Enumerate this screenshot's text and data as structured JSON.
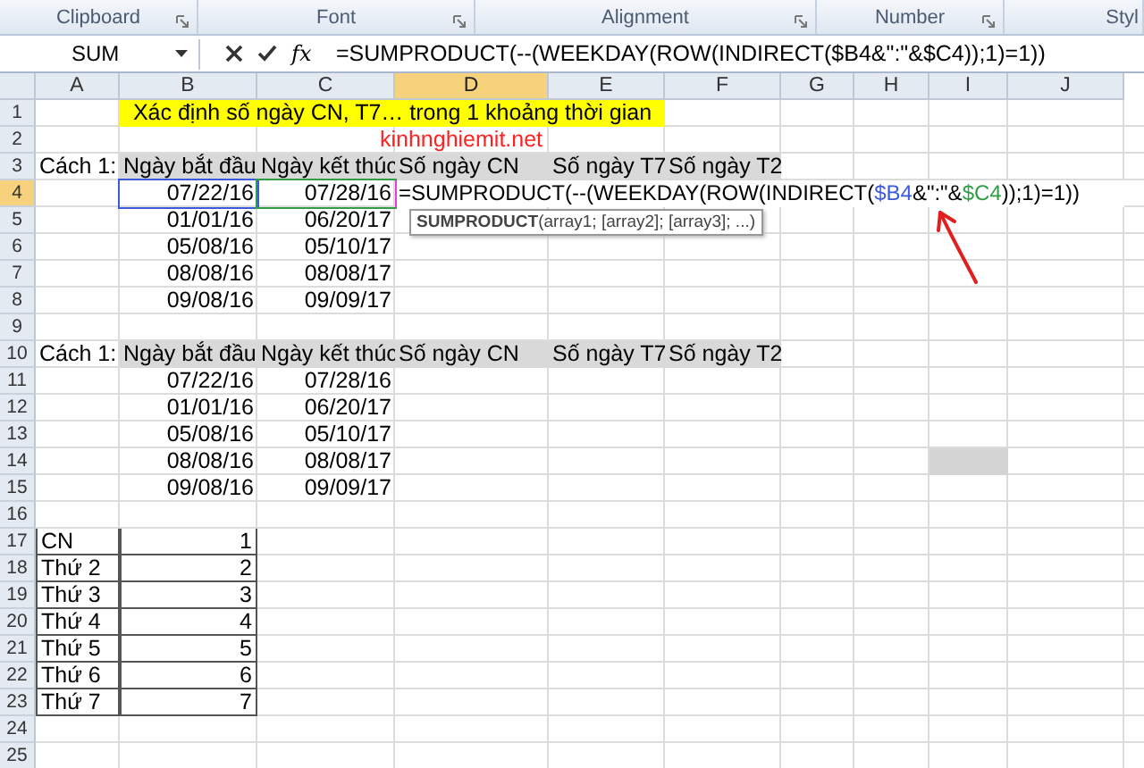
{
  "ribbon": {
    "groups": [
      {
        "label": "Clipboard"
      },
      {
        "label": "Font"
      },
      {
        "label": "Alignment"
      },
      {
        "label": "Number"
      },
      {
        "label": "Styl"
      }
    ]
  },
  "formula_bar": {
    "name_box": "SUM",
    "fx": "fx",
    "formula": "=SUMPRODUCT(--(WEEKDAY(ROW(INDIRECT($B4&\":\"&$C4));1)=1))"
  },
  "columns": [
    {
      "label": "A",
      "selected": false
    },
    {
      "label": "B",
      "selected": false
    },
    {
      "label": "C",
      "selected": false
    },
    {
      "label": "D",
      "selected": true
    },
    {
      "label": "E",
      "selected": false
    },
    {
      "label": "F",
      "selected": false
    },
    {
      "label": "G",
      "selected": false
    },
    {
      "label": "H",
      "selected": false
    },
    {
      "label": "I",
      "selected": false
    },
    {
      "label": "J",
      "selected": false
    }
  ],
  "rows": [
    {
      "number": "1",
      "selected": false,
      "kind": "title",
      "cells": {
        "b": "Xác định số ngày CN, T7… trong 1 khoảng thời gian"
      }
    },
    {
      "number": "2",
      "selected": false,
      "kind": "site",
      "cells": {
        "c": "kinhnghiemit.net"
      }
    },
    {
      "number": "3",
      "selected": false,
      "kind": "header",
      "cells": {
        "a": "Cách 1:",
        "b": "Ngày bắt đầu",
        "c": "Ngày kết thúc",
        "d": "Số ngày CN",
        "e": "Số ngày T7",
        "f": "Số ngày T2"
      }
    },
    {
      "number": "4",
      "selected": true,
      "kind": "data",
      "cells": {
        "b": "07/22/16",
        "c": "07/28/16"
      },
      "refs": {
        "b": {
          "color": "#3b5bdb"
        },
        "c": {
          "color": "#2f9e44"
        }
      },
      "formula_segments": [
        {
          "text": "=SUMPRODUCT(--(WEEKDAY(ROW(INDIRECT(",
          "color": "#000000"
        },
        {
          "text": "$B4",
          "color": "#3b5bdb"
        },
        {
          "text": "&\":\"&",
          "color": "#000000"
        },
        {
          "text": "$C4",
          "color": "#2f9e44"
        },
        {
          "text": "));1)=1))",
          "color": "#000000"
        }
      ]
    },
    {
      "number": "5",
      "selected": false,
      "kind": "data",
      "cells": {
        "b": "01/01/16",
        "c": "06/20/17"
      }
    },
    {
      "number": "6",
      "selected": false,
      "kind": "data",
      "cells": {
        "b": "05/08/16",
        "c": "05/10/17"
      }
    },
    {
      "number": "7",
      "selected": false,
      "kind": "data",
      "cells": {
        "b": "08/08/16",
        "c": "08/08/17"
      }
    },
    {
      "number": "8",
      "selected": false,
      "kind": "data",
      "cells": {
        "b": "09/08/16",
        "c": "09/09/17"
      }
    },
    {
      "number": "9",
      "selected": false,
      "kind": "blank",
      "cells": {}
    },
    {
      "number": "10",
      "selected": false,
      "kind": "header",
      "cells": {
        "a": "Cách 1:",
        "b": "Ngày bắt đầu",
        "c": "Ngày kết thúc",
        "d": "Số ngày CN",
        "e": "Số ngày T7",
        "f": "Số ngày T2"
      }
    },
    {
      "number": "11",
      "selected": false,
      "kind": "data",
      "cells": {
        "b": "07/22/16",
        "c": "07/28/16"
      }
    },
    {
      "number": "12",
      "selected": false,
      "kind": "data",
      "cells": {
        "b": "01/01/16",
        "c": "06/20/17"
      }
    },
    {
      "number": "13",
      "selected": false,
      "kind": "data",
      "cells": {
        "b": "05/08/16",
        "c": "05/10/17"
      }
    },
    {
      "number": "14",
      "selected": false,
      "kind": "data",
      "cells": {
        "b": "08/08/16",
        "c": "08/08/17"
      },
      "shaded": {
        "i": true
      }
    },
    {
      "number": "15",
      "selected": false,
      "kind": "data",
      "cells": {
        "b": "09/08/16",
        "c": "09/09/17"
      }
    },
    {
      "number": "16",
      "selected": false,
      "kind": "blank",
      "cells": {}
    },
    {
      "number": "17",
      "selected": false,
      "kind": "lookup",
      "cells": {
        "a": "CN",
        "b": "1"
      }
    },
    {
      "number": "18",
      "selected": false,
      "kind": "lookup",
      "cells": {
        "a": "Thứ 2",
        "b": "2"
      }
    },
    {
      "number": "19",
      "selected": false,
      "kind": "lookup",
      "cells": {
        "a": "Thứ 3",
        "b": "3"
      }
    },
    {
      "number": "20",
      "selected": false,
      "kind": "lookup",
      "cells": {
        "a": "Thứ 4",
        "b": "4"
      }
    },
    {
      "number": "21",
      "selected": false,
      "kind": "lookup",
      "cells": {
        "a": "Thứ 5",
        "b": "5"
      }
    },
    {
      "number": "22",
      "selected": false,
      "kind": "lookup",
      "cells": {
        "a": "Thứ 6",
        "b": "6"
      }
    },
    {
      "number": "23",
      "selected": false,
      "kind": "lookup",
      "cells": {
        "a": "Thứ 7",
        "b": "7"
      }
    },
    {
      "number": "24",
      "selected": false,
      "kind": "blank",
      "cells": {}
    },
    {
      "number": "25",
      "selected": false,
      "kind": "blank",
      "cells": {}
    }
  ],
  "tooltip": {
    "function": "SUMPRODUCT",
    "args": "(array1; [array2]; [array3]; ...)"
  }
}
